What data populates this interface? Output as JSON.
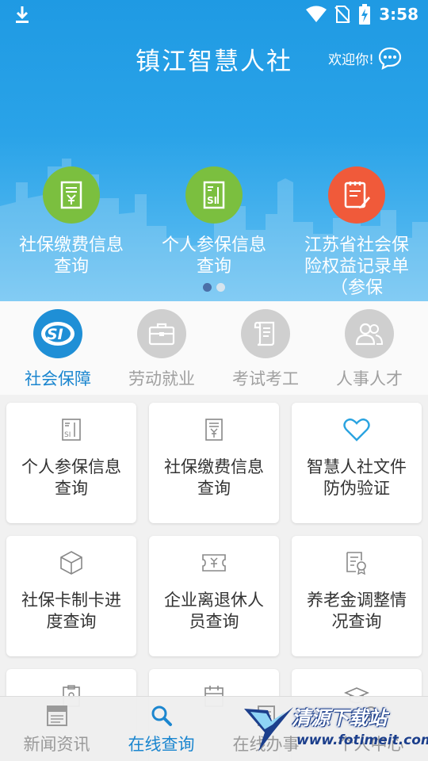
{
  "status_bar": {
    "time": "3:58"
  },
  "header": {
    "title": "镇江智慧人社",
    "welcome": "欢迎你!"
  },
  "banner": {
    "items": [
      {
        "label": "社保缴费信息查询",
        "color": "#7bbf3f",
        "icon": "receipt-yen-icon"
      },
      {
        "label": "个人参保信息查询",
        "color": "#7bbf3f",
        "icon": "si-card-icon"
      },
      {
        "label": "江苏省社会保险权益记录单（参保",
        "color": "#f05a3a",
        "icon": "clipboard-pen-icon"
      }
    ],
    "pages": 2,
    "active_page": 1
  },
  "categories": [
    {
      "label": "社会保障",
      "icon": "si-logo-icon",
      "active": true
    },
    {
      "label": "劳动就业",
      "icon": "briefcase-icon",
      "active": false
    },
    {
      "label": "考试考工",
      "icon": "scroll-icon",
      "active": false
    },
    {
      "label": "人事人才",
      "icon": "people-icon",
      "active": false
    }
  ],
  "services": [
    {
      "label": "个人参保信息查询",
      "icon": "si-card-icon"
    },
    {
      "label": "社保缴费信息查询",
      "icon": "receipt-yen-icon"
    },
    {
      "label": "智慧人社文件防伪验证",
      "icon": "heart-icon"
    },
    {
      "label": "社保卡制卡进度查询",
      "icon": "box-icon"
    },
    {
      "label": "企业离退休人员查询",
      "icon": "ticket-yen-icon"
    },
    {
      "label": "养老金调整情况查询",
      "icon": "certificate-icon"
    }
  ],
  "bottom_nav": [
    {
      "label": "新闻资讯",
      "icon": "news-icon",
      "active": false
    },
    {
      "label": "在线查询",
      "icon": "search-icon",
      "active": true
    },
    {
      "label": "在线办事",
      "icon": "doc-icon",
      "active": false
    },
    {
      "label": "个人中心",
      "icon": "user-icon",
      "active": false
    }
  ],
  "watermark": {
    "name": "清源下载站",
    "url": "www.fotimeit.com"
  },
  "colors": {
    "primary": "#1f9ae3",
    "active_text": "#1b86cf",
    "inactive_text": "#9a9a9a"
  }
}
